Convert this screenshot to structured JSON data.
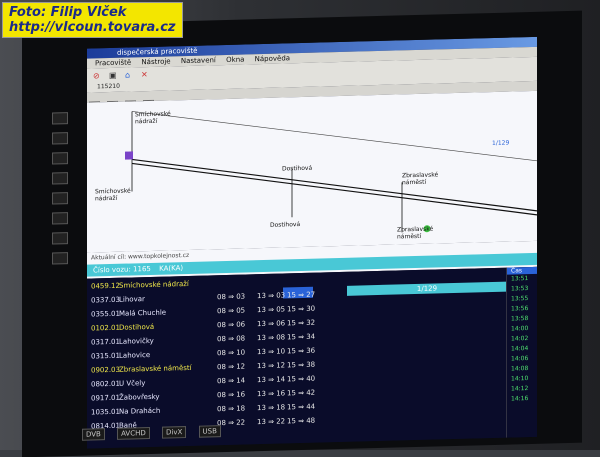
{
  "watermark": {
    "line1": "Foto: Filip Vlček",
    "line2": "http://vlcoun.tovara.cz"
  },
  "app": {
    "title": "dispečerská pracoviště",
    "menu": [
      "Pracoviště",
      "Nástroje",
      "Nastavení",
      "Okna",
      "Nápověda"
    ],
    "toolbar_code": "115210",
    "tabs": [
      "1",
      "2",
      "3",
      "4"
    ],
    "track_legend": "1 2 3 4 5 6 7 8 9 10 11 12 13 14 15 16 17 18 19 20 21 22 23 24 25 26"
  },
  "diagram": {
    "stations_top": [
      "Smíchovské nádraží",
      "Dostihová",
      "Zbraslavské náměstí"
    ],
    "stations_bottom": [
      "Smíchovské nádraží",
      "Dostihová",
      "Zbraslavské náměstí"
    ],
    "zoom": "1/129"
  },
  "info": {
    "path": "Aktuální cíl: www.topkolejnost.cz",
    "bar_line": "Číslo vozu: 1165",
    "bar_route": "KA(KA)"
  },
  "status_bar": {
    "label": "1/129"
  },
  "departures": [
    {
      "num": "0459.12",
      "name": "Smíchovské nádraží",
      "t1": "",
      "t2": "",
      "t3": "",
      "color": "#f1e84a"
    },
    {
      "num": "0337.03",
      "name": "Lihovar",
      "t1": "08 ⇒ 03",
      "t2": "13 ⇒ 03",
      "t3": "15 ⇒ 27",
      "color": "#e8e8ff"
    },
    {
      "num": "0355.01",
      "name": "Malá Chuchle",
      "t1": "08 ⇒ 05",
      "t2": "13 ⇒ 05",
      "t3": "15 ⇒ 30",
      "color": "#e8e8ff"
    },
    {
      "num": "0102.01",
      "name": "Dostihová",
      "t1": "08 ⇒ 06",
      "t2": "13 ⇒ 06",
      "t3": "15 ⇒ 32",
      "color": "#f1e84a"
    },
    {
      "num": "0317.01",
      "name": "Lahovičky",
      "t1": "08 ⇒ 08",
      "t2": "13 ⇒ 08",
      "t3": "15 ⇒ 34",
      "color": "#e8e8ff"
    },
    {
      "num": "0315.01",
      "name": "Lahovice",
      "t1": "08 ⇒ 10",
      "t2": "13 ⇒ 10",
      "t3": "15 ⇒ 36",
      "color": "#e8e8ff"
    },
    {
      "num": "0902.03",
      "name": "Zbraslavské náměstí",
      "t1": "08 ⇒ 12",
      "t2": "13 ⇒ 12",
      "t3": "15 ⇒ 38",
      "color": "#f1e84a"
    },
    {
      "num": "0802.01",
      "name": "U Včely",
      "t1": "08 ⇒ 14",
      "t2": "13 ⇒ 14",
      "t3": "15 ⇒ 40",
      "color": "#e8e8ff"
    },
    {
      "num": "0917.01",
      "name": "Žabovřesky",
      "t1": "08 ⇒ 16",
      "t2": "13 ⇒ 16",
      "t3": "15 ⇒ 42",
      "color": "#e8e8ff"
    },
    {
      "num": "1035.01",
      "name": "Na Drahách",
      "t1": "08 ⇒ 18",
      "t2": "13 ⇒ 18",
      "t3": "15 ⇒ 44",
      "color": "#e8e8ff"
    },
    {
      "num": "0814.01",
      "name": "Baně",
      "t1": "08 ⇒ 22",
      "t2": "13 ⇒ 22",
      "t3": "15 ⇒ 48",
      "color": "#e8e8ff"
    }
  ],
  "side_panel": {
    "header": "Čas",
    "items": [
      "13:51",
      "13:53",
      "13:55",
      "13:56",
      "13:58",
      "14:00",
      "14:02",
      "14:04",
      "14:06",
      "14:08",
      "14:10",
      "14:12",
      "14:16"
    ]
  },
  "tv_logos": [
    "DVB",
    "AVCHD",
    "DivX",
    "USB"
  ]
}
